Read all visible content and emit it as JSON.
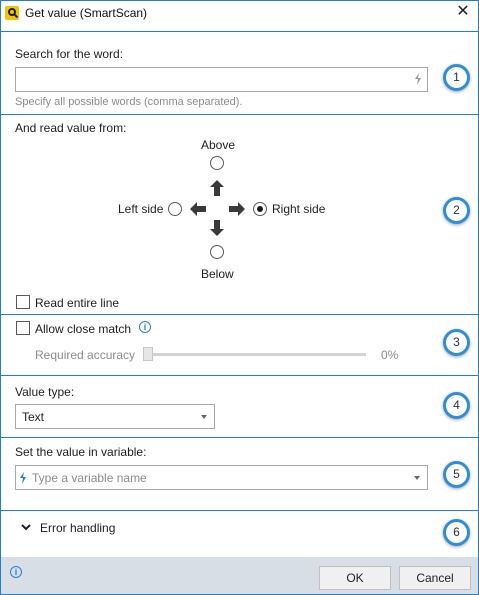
{
  "window": {
    "title": "Get value (SmartScan)",
    "close_glyph": "✕"
  },
  "steps": [
    "1",
    "2",
    "3",
    "4",
    "5",
    "6"
  ],
  "search": {
    "label": "Search for the word:",
    "value": "",
    "placeholder": "",
    "hint": "Specify all possible words (comma separated)."
  },
  "read_from": {
    "label": "And read value from:",
    "above": "Above",
    "left": "Left side",
    "right": "Right side",
    "below": "Below",
    "selected": "right",
    "entire_line_label": "Read entire line",
    "entire_line_checked": false
  },
  "close_match": {
    "label": "Allow close match",
    "checked": false,
    "accuracy_label": "Required accuracy",
    "accuracy_value": "0%",
    "accuracy_fraction": 0
  },
  "value_type": {
    "label": "Value type:",
    "selected": "Text"
  },
  "variable": {
    "label": "Set the value in variable:",
    "placeholder": "Type a variable name"
  },
  "error_handling": {
    "label": "Error handling",
    "expanded": false
  },
  "footer": {
    "ok_label": "OK",
    "cancel_label": "Cancel"
  },
  "icons": [
    "app-logo-icon",
    "close-icon",
    "lightning-icon",
    "arrow-up-icon",
    "arrow-left-icon",
    "arrow-right-icon",
    "arrow-down-icon",
    "info-icon",
    "chevron-down-icon"
  ],
  "colors": {
    "accent": "#1e7fd3",
    "badge_ring": "#2e8fd8",
    "footer_bg": "#d8dee6"
  }
}
